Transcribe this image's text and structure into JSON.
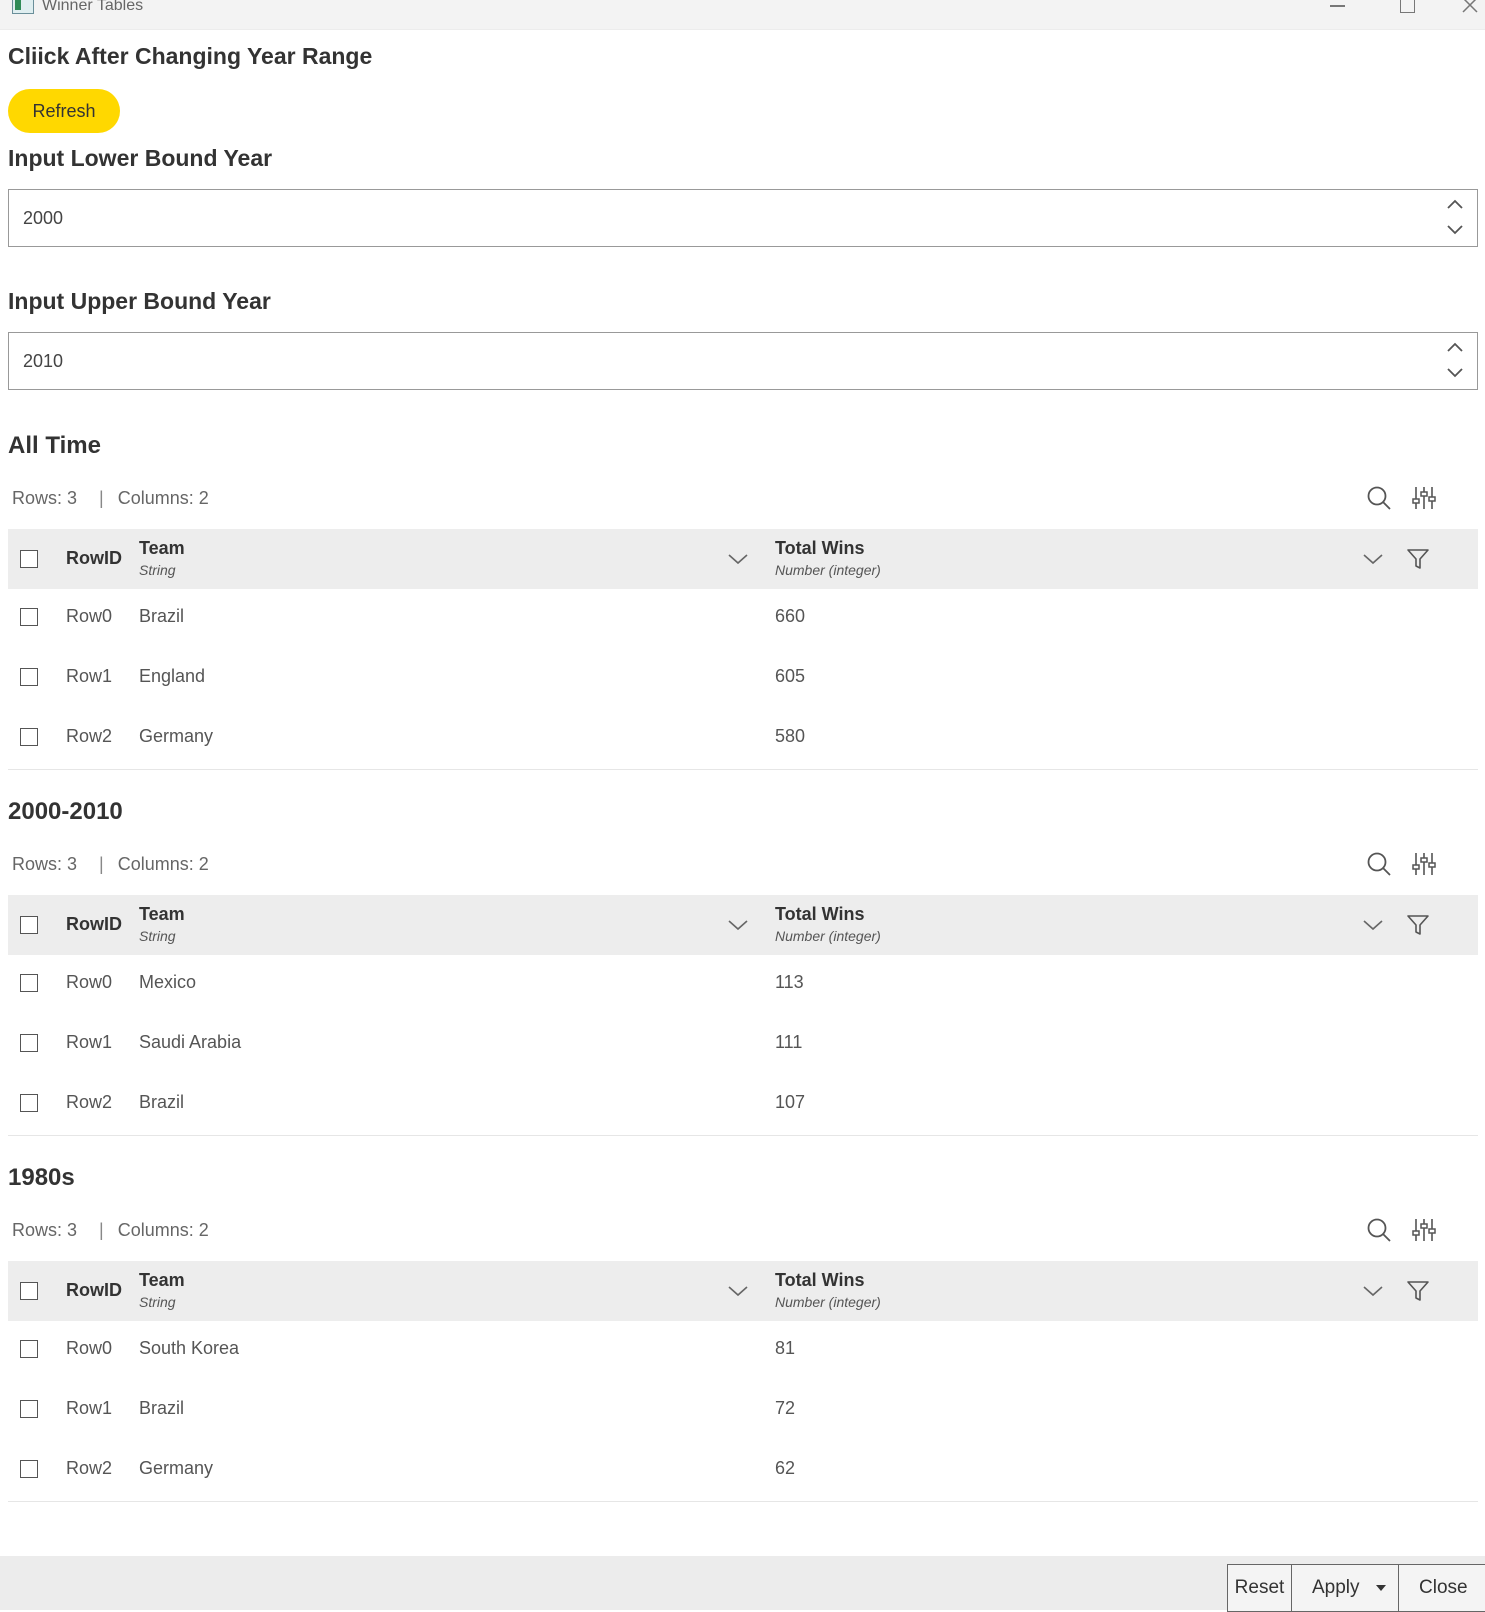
{
  "window": {
    "title": "Winner Tables"
  },
  "controls": {
    "prompt": "Cliick After Changing Year Range",
    "refresh_label": "Refresh",
    "lower_label": "Input Lower Bound Year",
    "lower_value": "2000",
    "upper_label": "Input Upper Bound Year",
    "upper_value": "2010"
  },
  "tables": [
    {
      "title": "All Time",
      "rows_label": "Rows: 3",
      "cols_label": "Columns: 2",
      "rowid_header": "RowID",
      "team_header": "Team",
      "team_type": "String",
      "wins_header": "Total Wins",
      "wins_type": "Number (integer)",
      "rows": [
        {
          "id": "Row0",
          "team": "Brazil",
          "wins": "660"
        },
        {
          "id": "Row1",
          "team": "England",
          "wins": "605"
        },
        {
          "id": "Row2",
          "team": "Germany",
          "wins": "580"
        }
      ]
    },
    {
      "title": "2000-2010",
      "rows_label": "Rows: 3",
      "cols_label": "Columns: 2",
      "rowid_header": "RowID",
      "team_header": "Team",
      "team_type": "String",
      "wins_header": "Total Wins",
      "wins_type": "Number (integer)",
      "rows": [
        {
          "id": "Row0",
          "team": "Mexico",
          "wins": "113"
        },
        {
          "id": "Row1",
          "team": "Saudi Arabia",
          "wins": "111"
        },
        {
          "id": "Row2",
          "team": "Brazil",
          "wins": "107"
        }
      ]
    },
    {
      "title": "1980s",
      "rows_label": "Rows: 3",
      "cols_label": "Columns: 2",
      "rowid_header": "RowID",
      "team_header": "Team",
      "team_type": "String",
      "wins_header": "Total Wins",
      "wins_type": "Number (integer)",
      "rows": [
        {
          "id": "Row0",
          "team": "South Korea",
          "wins": "81"
        },
        {
          "id": "Row1",
          "team": "Brazil",
          "wins": "72"
        },
        {
          "id": "Row2",
          "team": "Germany",
          "wins": "62"
        }
      ]
    }
  ],
  "footer": {
    "reset_label": "Reset",
    "apply_label": "Apply",
    "close_label": "Close"
  },
  "colors": {
    "accent": "#ffd800",
    "header_bg": "#ededed"
  }
}
